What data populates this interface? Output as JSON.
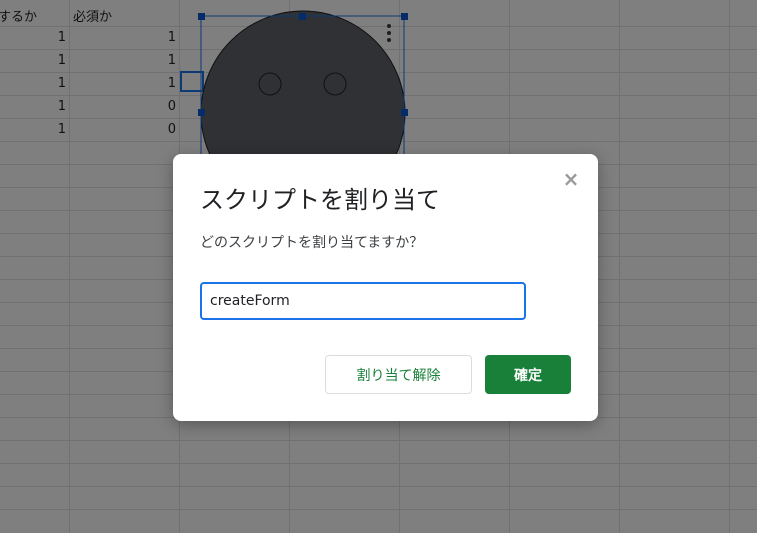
{
  "sheet": {
    "headers": [
      "するか",
      "必須か"
    ],
    "rows": [
      [
        "1",
        "1"
      ],
      [
        "1",
        "1"
      ],
      [
        "1",
        "1"
      ],
      [
        "1",
        "0"
      ],
      [
        "1",
        "0"
      ]
    ]
  },
  "drawing": {
    "menu_icon": "kebab-vertical-icon",
    "face_color": "#5f6368",
    "selection_color": "#1a73e8"
  },
  "dialog": {
    "title": "スクリプトを割り当て",
    "question": "どのスクリプトを割り当てますか？",
    "close_icon": "close-icon",
    "input_value": "createForm",
    "unassign_label": "割り当て解除",
    "confirm_label": "確定"
  },
  "colors": {
    "accent_green": "#188038",
    "focus_blue": "#1a73e8"
  }
}
